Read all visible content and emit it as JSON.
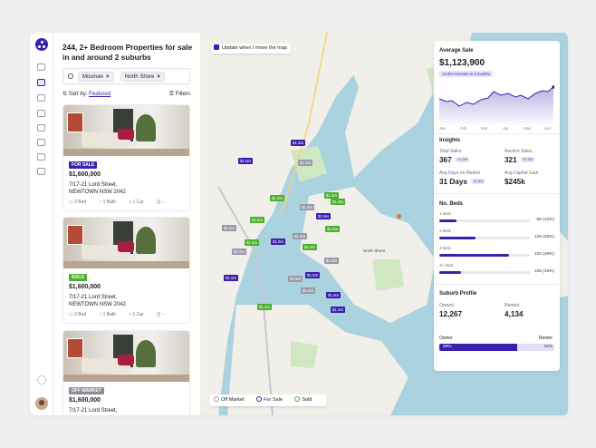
{
  "listing": {
    "title": "244, 2+ Bedroom Properties for sale in and around 2 suburbs",
    "chips": [
      {
        "label": "Mosman"
      },
      {
        "label": "North Shore"
      }
    ],
    "sort_prefix": "Sort by:",
    "sort_value": "Featured",
    "filters_label": "Filters",
    "cards": [
      {
        "badge": "FOR SALE",
        "badge_color": "#3b1fae",
        "price": "$1,600,000",
        "address_line1": "7/17-21 Lord Street,",
        "address_line2": "NEWTOWN NSW 2042",
        "bed": "2 Bed",
        "bath": "1 Bath",
        "car": "1 Car",
        "extra": "–"
      },
      {
        "badge": "SOLD",
        "badge_color": "#4caf2f",
        "price": "$1,600,000",
        "address_line1": "7/17-21 Lord Street,",
        "address_line2": "NEWTOWN NSW 2042",
        "bed": "2 Bed",
        "bath": "1 Bath",
        "car": "1 Car",
        "extra": "–"
      },
      {
        "badge": "OFF MARKET",
        "badge_color": "#8d8d99",
        "price": "$1,600,000",
        "address_line1": "7/17-21 Lord Street,",
        "address_line2": "",
        "bed": "",
        "bath": "",
        "car": "",
        "extra": ""
      }
    ]
  },
  "map": {
    "update_label": "Update when I move the map",
    "legend": {
      "off_market": "Off Market",
      "for_sale": "For Sale",
      "sold": "Sold"
    },
    "marker_label": "$1.5m",
    "north_shore_label": "North Shore"
  },
  "stats": {
    "avg_sale": {
      "heading": "Average Sale",
      "value": "$1,123,900",
      "change": "12.5% increase in 6 months",
      "months": [
        "Jan",
        "Feb",
        "Mar",
        "Apr",
        "May",
        "Jun"
      ]
    },
    "insights": {
      "heading": "Insights",
      "total_sales_label": "Total Sales",
      "total_sales": "367",
      "total_sales_tag": "+2.3%",
      "auction_label": "Auction Sales",
      "auction": "321",
      "auction_tag": "+2.3%",
      "days_label": "Avg Days on Market",
      "days": "31 Days",
      "days_tag": "+2.3%",
      "gain_label": "Avg Capital Gain",
      "gain": "$245k"
    },
    "beds": {
      "heading": "No. Beds",
      "rows": [
        {
          "label": "1 Bed",
          "value": "65 (12%)",
          "fraction": 0.12
        },
        {
          "label": "2 Bed",
          "value": "125 (25%)",
          "fraction": 0.25
        },
        {
          "label": "3 Bed",
          "value": "125 (48%)",
          "fraction": 0.48
        },
        {
          "label": "3+ Bed",
          "value": "125 (15%)",
          "fraction": 0.15
        }
      ]
    },
    "profile": {
      "heading": "Suburb Profile",
      "owned_label": "Owned",
      "owned": "12,267",
      "rented_label": "Rented",
      "rented": "4,134",
      "owner_label": "Owner",
      "renter_label": "Renter",
      "owner_pct": "68%",
      "renter_pct": "32%",
      "owner_fraction": 0.68
    }
  }
}
